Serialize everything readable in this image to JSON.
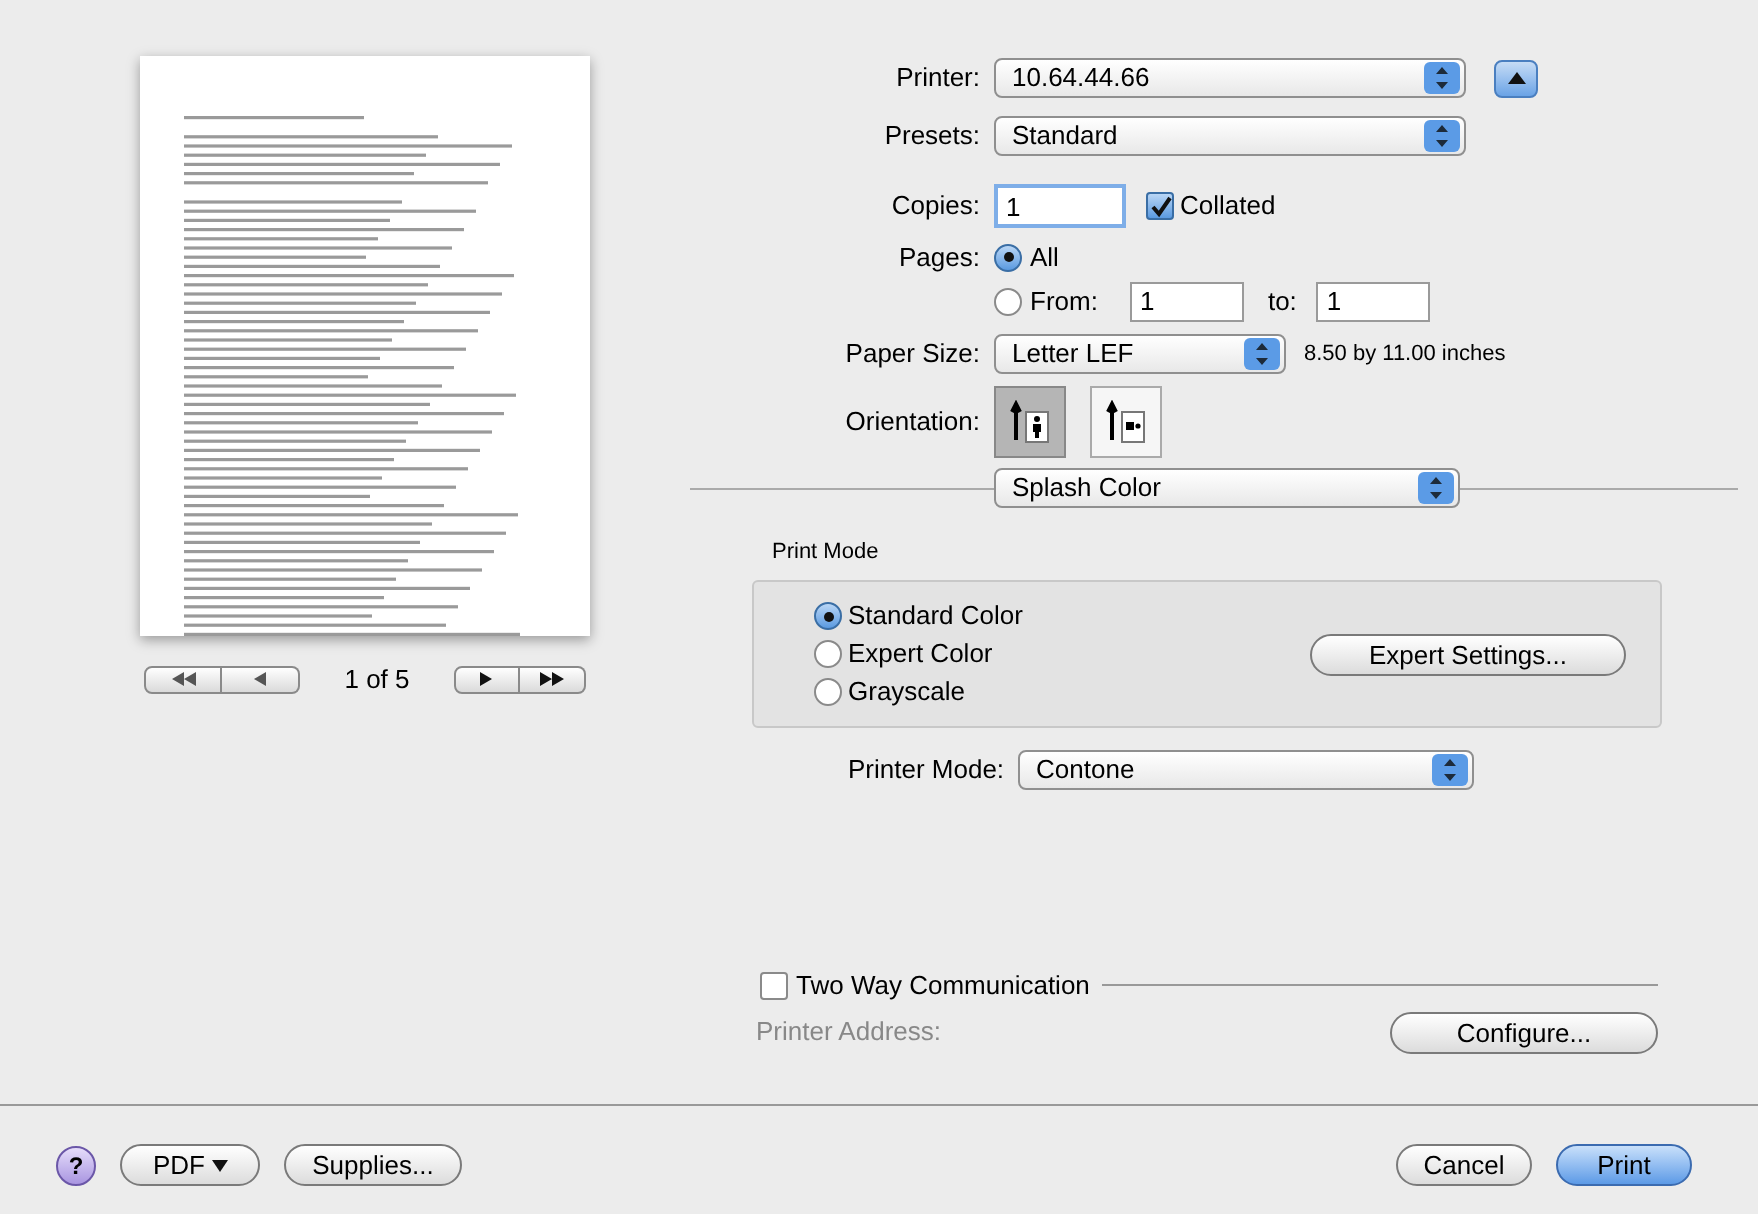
{
  "preview": {
    "page_label": "1 of 5"
  },
  "printer": {
    "label": "Printer:",
    "value": "10.64.44.66"
  },
  "presets": {
    "label": "Presets:",
    "value": "Standard"
  },
  "copies": {
    "label": "Copies:",
    "value": "1"
  },
  "collated": {
    "label": "Collated",
    "checked": true
  },
  "pages": {
    "label": "Pages:",
    "options": [
      {
        "label": "All",
        "selected": true
      },
      {
        "label": "From:",
        "selected": false
      }
    ],
    "from": "1",
    "to_label": "to:",
    "to": "1"
  },
  "paper_size": {
    "label": "Paper Size:",
    "value": "Letter LEF",
    "dimensions": "8.50 by 11.00 inches"
  },
  "orientation": {
    "label": "Orientation:",
    "options": [
      {
        "kind": "portrait",
        "selected": true
      },
      {
        "kind": "landscape",
        "selected": false
      }
    ]
  },
  "panel_menu": {
    "value": "Splash Color"
  },
  "print_mode": {
    "title": "Print Mode",
    "options": [
      {
        "label": "Standard Color",
        "selected": true
      },
      {
        "label": "Expert Color",
        "selected": false
      },
      {
        "label": "Grayscale",
        "selected": false
      }
    ],
    "expert_button": "Expert Settings..."
  },
  "printer_mode": {
    "label": "Printer Mode:",
    "value": "Contone"
  },
  "two_way": {
    "label": "Two Way Communication",
    "checked": false
  },
  "printer_address": {
    "label": "Printer Address:"
  },
  "configure_button": "Configure...",
  "footer": {
    "help": "?",
    "pdf": "PDF",
    "supplies": "Supplies...",
    "cancel": "Cancel",
    "print": "Print"
  }
}
